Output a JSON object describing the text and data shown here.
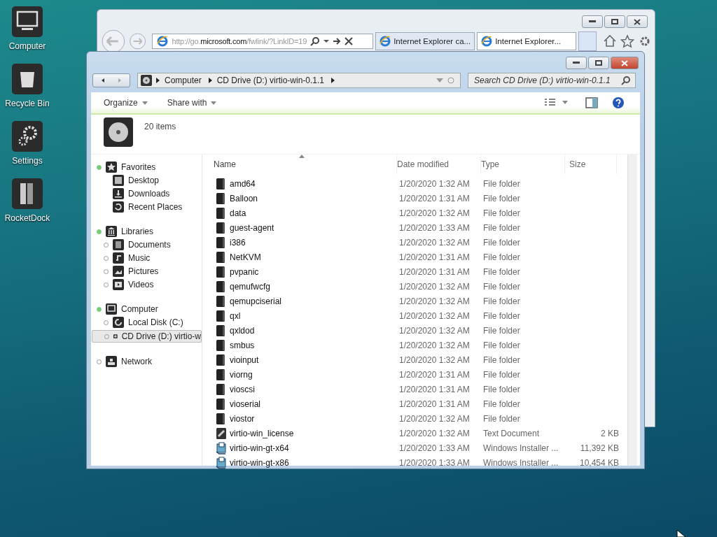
{
  "desktop_icons": [
    {
      "label": "Computer",
      "kind": "computer"
    },
    {
      "label": "Recycle Bin",
      "kind": "recycle"
    },
    {
      "label": "Settings",
      "kind": "settings"
    },
    {
      "label": "RocketDock",
      "kind": "dock"
    }
  ],
  "browser": {
    "address": {
      "prefix": "http://go.",
      "host": "microsoft.com",
      "rest": "/fwlink/?LinkID=19"
    },
    "tabs": [
      {
        "title": "Internet Explorer ca...",
        "selected": false
      },
      {
        "title": "Internet Explorer...",
        "selected": true
      }
    ]
  },
  "explorer": {
    "breadcrumb": [
      "Computer",
      "CD Drive (D:) virtio-win-0.1.1"
    ],
    "search": {
      "placeholder": "Search CD Drive (D:) virtio-win-0.1.1"
    },
    "toolbar": [
      "Organize",
      "Share with"
    ],
    "item_count": "20 items",
    "nav": [
      {
        "label": "Favorites",
        "kind": "star",
        "expanded": true,
        "children": [
          {
            "label": "Desktop",
            "kind": "desktop",
            "selected": false
          },
          {
            "label": "Downloads",
            "kind": "download",
            "selected": false
          },
          {
            "label": "Recent Places",
            "kind": "recent",
            "selected": false
          }
        ]
      },
      {
        "label": "Libraries",
        "kind": "library",
        "expanded": true,
        "children": [
          {
            "label": "Documents",
            "kind": "doc",
            "selected": false,
            "expanded": false
          },
          {
            "label": "Music",
            "kind": "music",
            "selected": false,
            "expanded": false
          },
          {
            "label": "Pictures",
            "kind": "picture",
            "selected": false,
            "expanded": false
          },
          {
            "label": "Videos",
            "kind": "video",
            "selected": false,
            "expanded": false
          }
        ]
      },
      {
        "label": "Computer",
        "kind": "monitor",
        "expanded": true,
        "children": [
          {
            "label": "Local Disk (C:)",
            "kind": "disk",
            "selected": false,
            "expanded": false
          },
          {
            "label": "CD Drive (D:) virtio-w",
            "kind": "cd",
            "selected": true,
            "expanded": false
          }
        ]
      },
      {
        "label": "Network",
        "kind": "network",
        "expanded": false
      }
    ],
    "columns": [
      "Name",
      "Date modified",
      "Type",
      "Size"
    ],
    "rows": [
      {
        "name": "amd64",
        "date": "1/20/2020 1:32 AM",
        "type": "File folder",
        "kind": "folder"
      },
      {
        "name": "Balloon",
        "date": "1/20/2020 1:31 AM",
        "type": "File folder",
        "kind": "folder"
      },
      {
        "name": "data",
        "date": "1/20/2020 1:32 AM",
        "type": "File folder",
        "kind": "folder"
      },
      {
        "name": "guest-agent",
        "date": "1/20/2020 1:33 AM",
        "type": "File folder",
        "kind": "folder"
      },
      {
        "name": "i386",
        "date": "1/20/2020 1:32 AM",
        "type": "File folder",
        "kind": "folder"
      },
      {
        "name": "NetKVM",
        "date": "1/20/2020 1:31 AM",
        "type": "File folder",
        "kind": "folder"
      },
      {
        "name": "pvpanic",
        "date": "1/20/2020 1:31 AM",
        "type": "File folder",
        "kind": "folder"
      },
      {
        "name": "qemufwcfg",
        "date": "1/20/2020 1:32 AM",
        "type": "File folder",
        "kind": "folder"
      },
      {
        "name": "qemupciserial",
        "date": "1/20/2020 1:32 AM",
        "type": "File folder",
        "kind": "folder"
      },
      {
        "name": "qxl",
        "date": "1/20/2020 1:32 AM",
        "type": "File folder",
        "kind": "folder"
      },
      {
        "name": "qxldod",
        "date": "1/20/2020 1:32 AM",
        "type": "File folder",
        "kind": "folder"
      },
      {
        "name": "smbus",
        "date": "1/20/2020 1:32 AM",
        "type": "File folder",
        "kind": "folder"
      },
      {
        "name": "vioinput",
        "date": "1/20/2020 1:32 AM",
        "type": "File folder",
        "kind": "folder"
      },
      {
        "name": "viorng",
        "date": "1/20/2020 1:31 AM",
        "type": "File folder",
        "kind": "folder"
      },
      {
        "name": "vioscsi",
        "date": "1/20/2020 1:31 AM",
        "type": "File folder",
        "kind": "folder"
      },
      {
        "name": "vioserial",
        "date": "1/20/2020 1:31 AM",
        "type": "File folder",
        "kind": "folder"
      },
      {
        "name": "viostor",
        "date": "1/20/2020 1:32 AM",
        "type": "File folder",
        "kind": "folder"
      },
      {
        "name": "virtio-win_license",
        "date": "1/20/2020 1:32 AM",
        "type": "Text Document",
        "size": "2 KB",
        "kind": "text"
      },
      {
        "name": "virtio-win-gt-x64",
        "date": "1/20/2020 1:33 AM",
        "type": "Windows Installer ...",
        "size": "11,392 KB",
        "kind": "installer"
      },
      {
        "name": "virtio-win-gt-x86",
        "date": "1/20/2020 1:33 AM",
        "type": "Windows Installer ...",
        "size": "10,454 KB",
        "kind": "installer"
      }
    ]
  }
}
